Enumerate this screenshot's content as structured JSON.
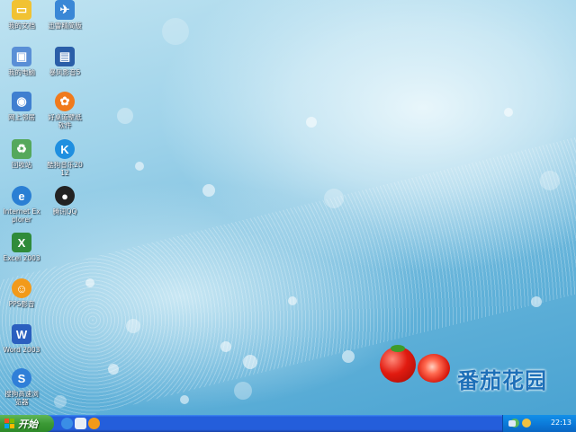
{
  "desktop": {
    "icons_col1": [
      {
        "label": "我的文档",
        "icon": "my-documents-icon",
        "color": "#f1c232"
      },
      {
        "label": "我的电脑",
        "icon": "my-computer-icon",
        "color": "#5a8fd6"
      },
      {
        "label": "网上邻居",
        "icon": "network-places-icon",
        "color": "#3f7fd0"
      },
      {
        "label": "回收站",
        "icon": "recycle-bin-icon",
        "color": "#55a85c"
      },
      {
        "label": "Internet Explorer",
        "icon": "internet-explorer-icon",
        "color": "#2a7fd4"
      },
      {
        "label": "Excel 2003",
        "icon": "excel-icon",
        "color": "#2f8b3a"
      },
      {
        "label": "PPS影音",
        "icon": "pps-player-icon",
        "color": "#f29a1a"
      },
      {
        "label": "Word 2003",
        "icon": "word-icon",
        "color": "#2b5fbf"
      },
      {
        "label": "搜狗高速浏览器",
        "icon": "sogou-browser-icon",
        "color": "#2f7fd8"
      }
    ],
    "icons_col2": [
      {
        "label": "迅雷精简版",
        "icon": "thunder-icon",
        "color": "#3a87d6"
      },
      {
        "label": "暴风影音5",
        "icon": "baofeng-player-icon",
        "color": "#2a5ea8"
      },
      {
        "label": "好桌道壁纸软件",
        "icon": "wallpaper-software-icon",
        "color": "#f07a1c"
      },
      {
        "label": "酷狗音乐2012",
        "icon": "kugou-music-icon",
        "color": "#1f8fe0"
      },
      {
        "label": "腾讯QQ",
        "icon": "qq-icon",
        "color": "#222222"
      }
    ],
    "logo_text": "番茄花园"
  },
  "taskbar": {
    "start_label": "开始",
    "clock": "22:13"
  }
}
